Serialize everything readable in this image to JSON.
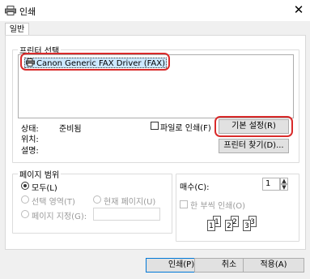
{
  "window": {
    "title": "인쇄"
  },
  "tabs": [
    {
      "label": "일반"
    }
  ],
  "printer_section": {
    "label": "프린터 선택",
    "printers": [
      {
        "name": "Canon Generic FAX Driver (FAX)",
        "selected": true
      }
    ],
    "status_label": "상태:",
    "status_value": "준비됨",
    "location_label": "위치:",
    "comment_label": "설명:",
    "print_to_file_label": "파일로 인쇄(F)",
    "preferences_button": "기본 설정(R)",
    "find_printer_button": "프린터 찾기(D)..."
  },
  "page_range": {
    "label": "페이지 범위",
    "all_label": "모두(L)",
    "selection_label": "선택 영역(T)",
    "current_page_label": "현재 페이지(U)",
    "pages_label": "페이지 지정(G):",
    "pages_value": ""
  },
  "copies": {
    "label": "매수(C):",
    "value": "1",
    "collate_label": "한 부씩 인쇄(O)",
    "collate_pages": [
      "1",
      "1",
      "2",
      "2",
      "3",
      "3"
    ]
  },
  "footer": {
    "print_button": "인쇄(P)",
    "cancel_button": "취소",
    "apply_button": "적용(A)"
  },
  "colors": {
    "highlight": "#d92b2b",
    "selection": "#cce8ff",
    "accent": "#0078d7"
  }
}
